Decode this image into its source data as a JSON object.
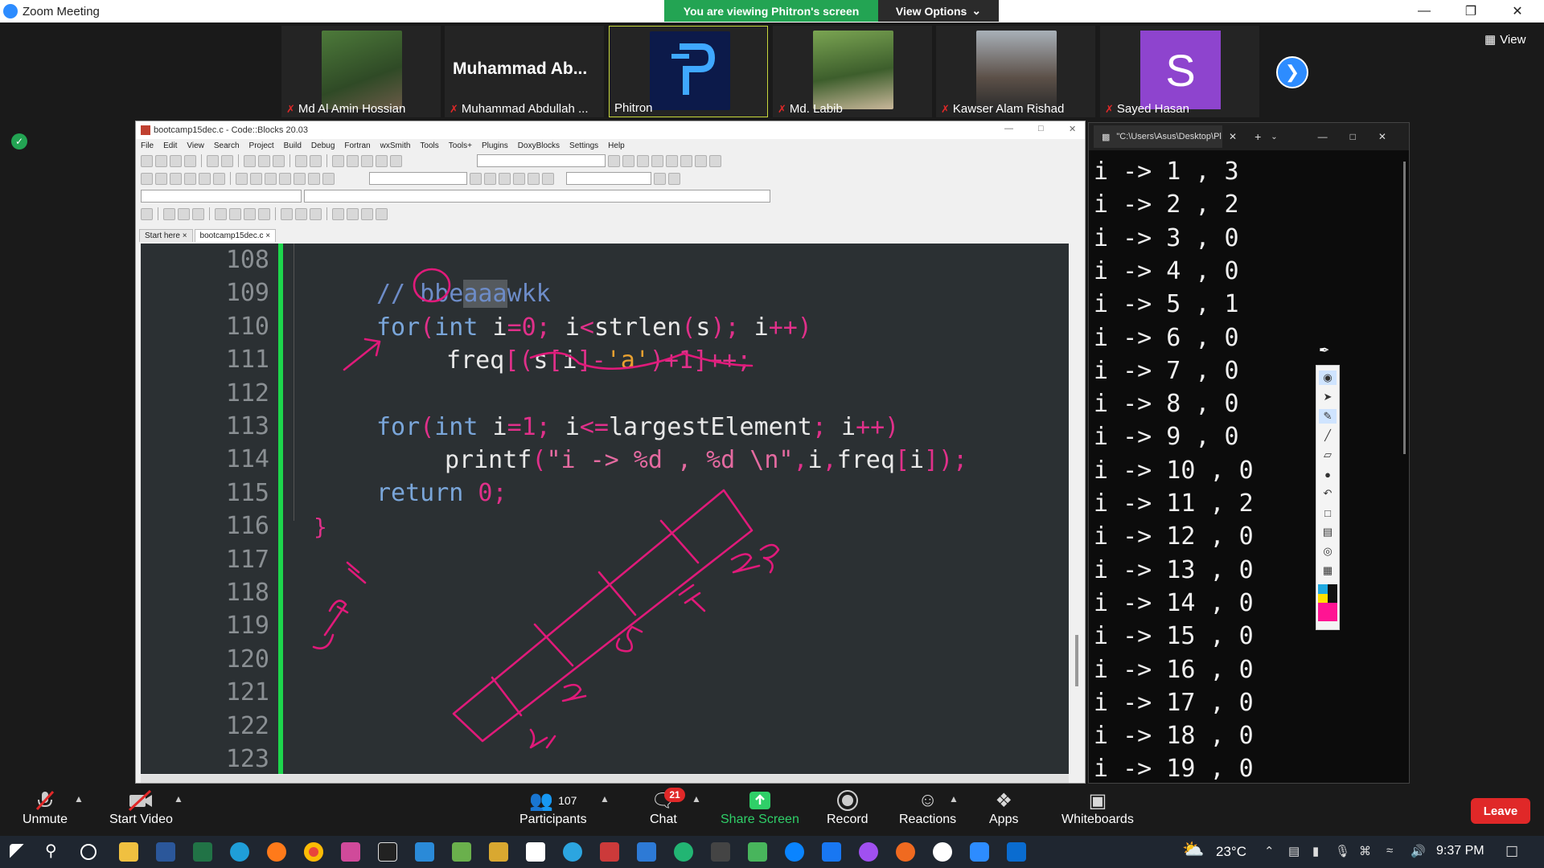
{
  "zoom": {
    "title": "Zoom Meeting",
    "banner": "You are viewing Phitron's screen",
    "view_options": "View Options",
    "view_label": "View"
  },
  "participants": [
    {
      "name": "Md Al Amin Hossian",
      "muted": true
    },
    {
      "name": "Muhammad Abdullah ...",
      "big_label": "Muhammad  Ab...",
      "muted": true
    },
    {
      "name": "Phitron",
      "muted": false
    },
    {
      "name": "Md. Labib",
      "muted": true
    },
    {
      "name": "Kawser Alam Rishad",
      "muted": true
    },
    {
      "name": "Sayed Hasan",
      "avatar_letter": "S",
      "muted": true
    }
  ],
  "codeblocks": {
    "title": "bootcamp15dec.c - Code::Blocks 20.03",
    "menu": [
      "File",
      "Edit",
      "View",
      "Search",
      "Project",
      "Build",
      "Debug",
      "Fortran",
      "wxSmith",
      "Tools",
      "Tools+",
      "Plugins",
      "DoxyBlocks",
      "Settings",
      "Help"
    ],
    "tabs": [
      "Start here",
      "bootcamp15dec.c"
    ],
    "line_numbers": [
      "108",
      "109",
      "110",
      "111",
      "112",
      "113",
      "114",
      "115",
      "116",
      "117",
      "118",
      "119",
      "120",
      "121",
      "122",
      "123"
    ],
    "code": {
      "l109_a": "// bbe",
      "l109_sel": "aaa",
      "l109_b": "wkk",
      "l110_kw": "for",
      "l110_a": "(",
      "l110_int": "int",
      "l110_b": " i",
      "l110_c": "=0;",
      "l110_d": " i",
      "l110_e": "<",
      "l110_f": "strlen",
      "l110_g": "(",
      "l110_h": "s",
      "l110_i": ");",
      "l110_j": " i",
      "l110_k": "++)",
      "l111_a": "freq",
      "l111_b": "[(",
      "l111_c": "s",
      "l111_d": "[",
      "l111_e": "i",
      "l111_f": "]-",
      "l111_g": "'a'",
      "l111_h": ")+1]++;",
      "l113_kw": "for",
      "l113_a": "(",
      "l113_int": "int",
      "l113_b": " i",
      "l113_c": "=1;",
      "l113_d": " i",
      "l113_e": "<=",
      "l113_f": "largestElement",
      "l113_g": ";",
      "l113_h": " i",
      "l113_i": "++)",
      "l114_a": "printf",
      "l114_b": "(",
      "l114_c": "\"i -> %d , %d \\n\"",
      "l114_d": ",",
      "l114_e": "i",
      "l114_f": ",",
      "l114_g": "freq",
      "l114_h": "[",
      "l114_i": "i",
      "l114_j": "]);",
      "l115_kw": "return",
      "l115_a": " 0;",
      "l116": "}"
    }
  },
  "terminal": {
    "tab_title": "\"C:\\Users\\Asus\\Desktop\\Pl",
    "lines": [
      "i -> 1 , 3",
      "i -> 2 , 2",
      "i -> 3 , 0",
      "i -> 4 , 0",
      "i -> 5 , 1",
      "i -> 6 , 0",
      "i -> 7 , 0",
      "i -> 8 , 0",
      "i -> 9 , 0",
      "i -> 10 , 0",
      "i -> 11 , 2",
      "i -> 12 , 0",
      "i -> 13 , 0",
      "i -> 14 , 0",
      "i -> 15 , 0",
      "i -> 16 , 0",
      "i -> 17 , 0",
      "i -> 18 , 0",
      "i -> 19 , 0"
    ]
  },
  "controls": {
    "unmute": "Unmute",
    "start_video": "Start Video",
    "participants": "Participants",
    "participants_count": "107",
    "chat": "Chat",
    "chat_badge": "21",
    "share_screen": "Share Screen",
    "record": "Record",
    "reactions": "Reactions",
    "apps": "Apps",
    "whiteboards": "Whiteboards",
    "leave": "Leave"
  },
  "taskbar": {
    "temperature": "23°C",
    "time": "9:37 PM"
  },
  "colors": {
    "banner_green": "#23a453",
    "zoom_blue": "#2d8cff",
    "leave_red": "#e02828",
    "ink_pink": "#e01a7a",
    "gutter_green": "#1dd64c"
  }
}
